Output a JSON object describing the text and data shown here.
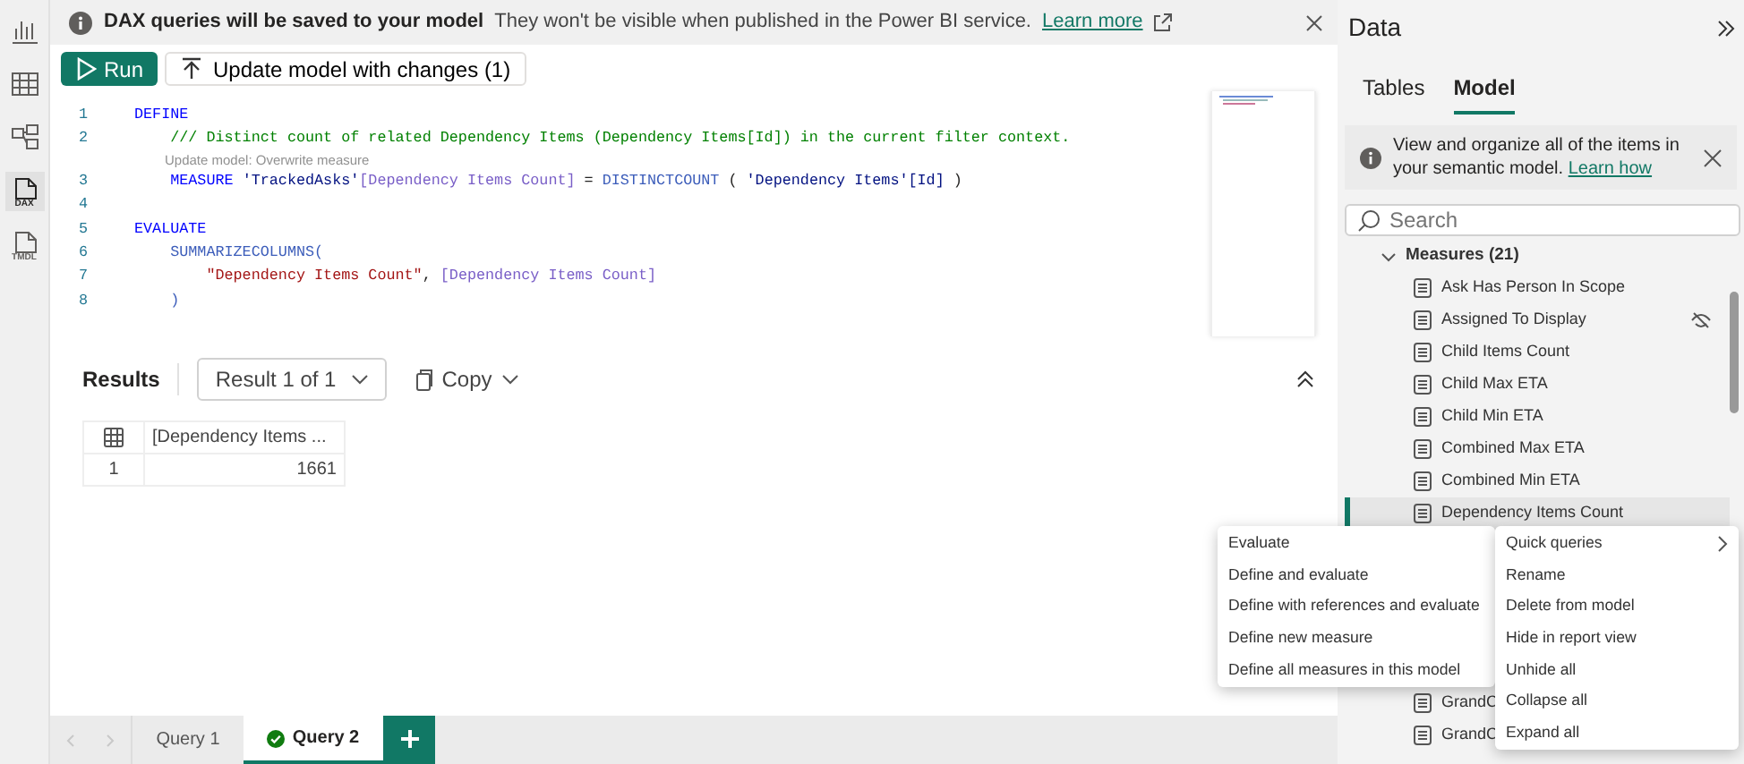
{
  "rail": [
    {
      "kind": "report",
      "selected": false
    },
    {
      "kind": "table",
      "selected": false
    },
    {
      "kind": "model",
      "selected": false
    },
    {
      "kind": "dax",
      "label": "DAX",
      "selected": true
    },
    {
      "kind": "tmdl",
      "label": "TMDL",
      "selected": false
    }
  ],
  "banner": {
    "title": "DAX queries will be saved to your model",
    "message": "They won't be visible when published in the Power BI service.",
    "link": "Learn more"
  },
  "toolbar": {
    "run": "Run",
    "update": "Update model with changes (1)"
  },
  "editor": {
    "lines": [
      {
        "kind": "code",
        "number": "1",
        "tokens": [
          {
            "kind": "keyword",
            "text": "DEFINE"
          }
        ]
      },
      {
        "kind": "code",
        "number": "2",
        "tokens": [
          {
            "kind": "comment",
            "text": "    /// Distinct count of related Dependency Items (Dependency Items[Id]) in the current filter context."
          }
        ]
      },
      {
        "kind": "lens",
        "text": "Update model: Overwrite measure"
      },
      {
        "kind": "code",
        "number": "3",
        "tokens": [
          {
            "kind": "keyword",
            "text": "    MEASURE "
          },
          {
            "kind": "table",
            "text": "'TrackedAsks'"
          },
          {
            "kind": "column",
            "text": "[Dependency Items Count]"
          },
          {
            "kind": "plain",
            "text": " = "
          },
          {
            "kind": "function",
            "text": "DISTINCTCOUNT"
          },
          {
            "kind": "plain",
            "text": " ( "
          },
          {
            "kind": "table",
            "text": "'Dependency Items'[Id]"
          },
          {
            "kind": "plain",
            "text": " )"
          }
        ]
      },
      {
        "kind": "code",
        "number": "4"
      },
      {
        "kind": "code",
        "number": "5",
        "tokens": [
          {
            "kind": "keyword",
            "text": "EVALUATE"
          }
        ]
      },
      {
        "kind": "code",
        "number": "6",
        "tokens": [
          {
            "kind": "function",
            "text": "    SUMMARIZECOLUMNS("
          }
        ]
      },
      {
        "kind": "code",
        "number": "7",
        "tokens": [
          {
            "kind": "string",
            "text": "        \"Dependency Items Count\""
          },
          {
            "kind": "plain",
            "text": ", "
          },
          {
            "kind": "column",
            "text": "[Dependency Items Count]"
          }
        ]
      },
      {
        "kind": "code",
        "number": "8",
        "tokens": [
          {
            "kind": "function",
            "text": "    )"
          }
        ]
      }
    ]
  },
  "results": {
    "title": "Results",
    "picker": "Result 1 of 1",
    "copy": "Copy",
    "columns": [
      "[Dependency Items ..."
    ],
    "rows": [
      {
        "number": "1",
        "cells": [
          "1661"
        ]
      }
    ]
  },
  "query_tabs": [
    {
      "label": "Query 1",
      "selected": false,
      "check": false
    },
    {
      "label": "Query 2",
      "selected": true,
      "check": true
    }
  ],
  "data_panel": {
    "title": "Data",
    "tabs": [
      {
        "label": "Tables",
        "selected": false
      },
      {
        "label": "Model",
        "selected": true
      }
    ],
    "info": {
      "text": "View and organize all of the items in your semantic model.",
      "link": "Learn how"
    },
    "search": {
      "placeholder": "Search"
    },
    "tree": {
      "label": "Measures (21)",
      "expanded": true,
      "children": [
        {
          "label": "Ask Has Person In Scope",
          "hidden": false,
          "selected": false
        },
        {
          "label": "Assigned To Display",
          "hidden": true,
          "selected": false
        },
        {
          "label": "Child Items Count",
          "hidden": false,
          "selected": false
        },
        {
          "label": "Child Max ETA",
          "hidden": false,
          "selected": false
        },
        {
          "label": "Child Min ETA",
          "hidden": false,
          "selected": false
        },
        {
          "label": "Combined Max ETA",
          "hidden": false,
          "selected": false
        },
        {
          "label": "Combined Min ETA",
          "hidden": false,
          "selected": false
        },
        {
          "label": "Dependency Items Count",
          "hidden": false,
          "selected": true
        }
      ],
      "lower_children": [
        {
          "label": "GrandC",
          "selected": false
        },
        {
          "label": "GrandC",
          "selected": false
        }
      ]
    }
  },
  "menu_left": [
    {
      "label": "Evaluate"
    },
    {
      "label": "Define and evaluate"
    },
    {
      "label": "Define with references and evaluate"
    },
    {
      "label": "Define new measure"
    },
    {
      "label": "Define all measures in this model"
    }
  ],
  "menu_right": [
    {
      "label": "Quick queries",
      "submenu": true
    },
    {
      "label": "Rename",
      "submenu": false
    },
    {
      "label": "Delete from model",
      "submenu": false
    },
    {
      "label": "Hide in report view",
      "submenu": false
    },
    {
      "label": "Unhide all",
      "submenu": false
    },
    {
      "label": "Collapse all",
      "submenu": false
    },
    {
      "label": "Expand all",
      "submenu": false
    }
  ]
}
